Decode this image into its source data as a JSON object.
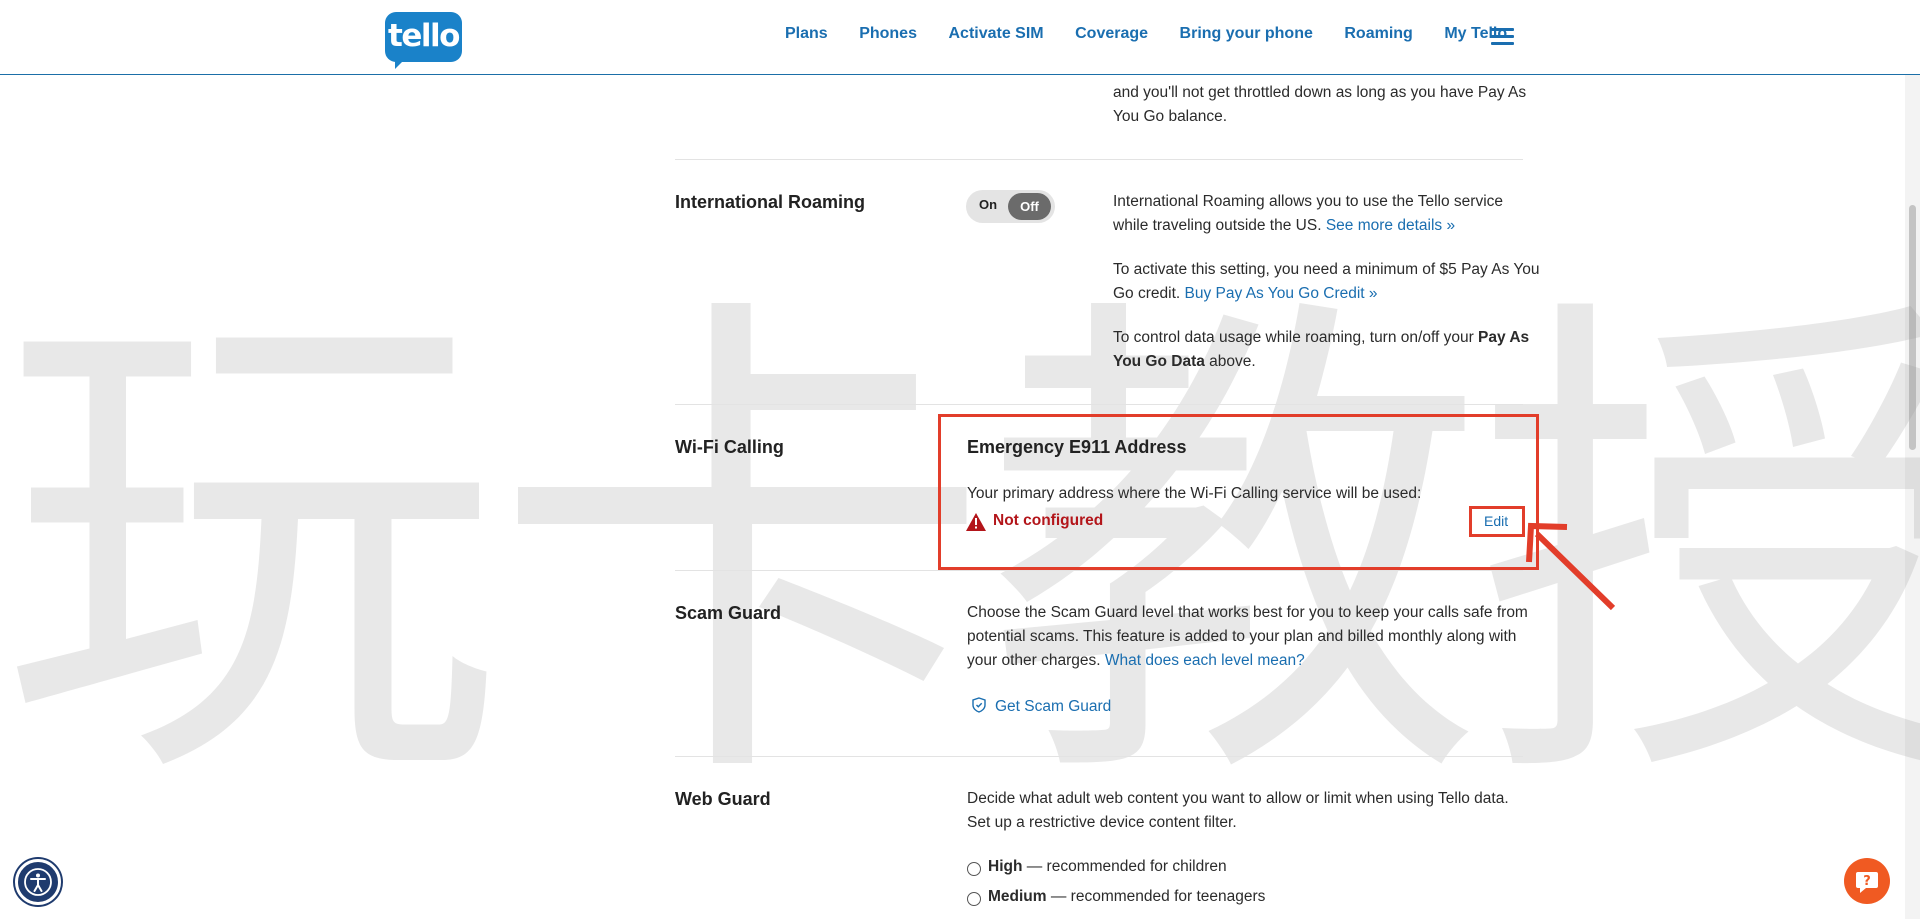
{
  "header": {
    "logo_text": "tello",
    "nav": [
      "Plans",
      "Phones",
      "Activate SIM",
      "Coverage",
      "Bring your phone",
      "Roaming",
      "My Tello"
    ]
  },
  "watermark": "玩卡教授",
  "data_section": {
    "text_line1": "and you'll not get throttled down as long as you have Pay As",
    "text_line2": "You Go balance."
  },
  "international_roaming": {
    "label": "International Roaming",
    "toggle_on": "On",
    "toggle_off": "Off",
    "p1_line1": "International Roaming allows you to use the Tello service",
    "p1_line2_text": "while traveling outside the US.",
    "p1_link": "See more details »",
    "p2_line1": "To activate this setting, you need a minimum of $5 Pay As You",
    "p2_line2_text": "Go credit.",
    "p2_link": "Buy Pay As You Go Credit »",
    "p3_line1_text": "To control data usage while roaming, turn on/off your",
    "p3_line1_bold": "Pay As",
    "p3_line2_bold": "You Go Data",
    "p3_line2_text": "above."
  },
  "wifi_calling": {
    "label": "Wi-Fi Calling",
    "title": "Emergency E911 Address",
    "description": "Your primary address where the Wi-Fi Calling service will be used:",
    "status": "Not configured",
    "edit": "Edit"
  },
  "scam_guard": {
    "label": "Scam Guard",
    "line1": "Choose the Scam Guard level that works best for you to keep your calls safe from",
    "line2": "potential scams. This feature is added to your plan and billed monthly along with",
    "line3_text": "your other charges.",
    "line3_link": "What does each level mean?",
    "button": "Get Scam Guard"
  },
  "web_guard": {
    "label": "Web Guard",
    "line1": "Decide what adult web content you want to allow or limit when using Tello data.",
    "line2": "Set up a restrictive device content filter.",
    "options": [
      {
        "name": "High",
        "desc": "— recommended for children"
      },
      {
        "name": "Medium",
        "desc": "— recommended for teenagers"
      }
    ]
  },
  "colors": {
    "brand_blue": "#1a82c9",
    "link_blue": "#1a6eb0",
    "error_red": "#b3151a",
    "annotation_red": "#e23d2a",
    "help_orange": "#f05a22"
  }
}
